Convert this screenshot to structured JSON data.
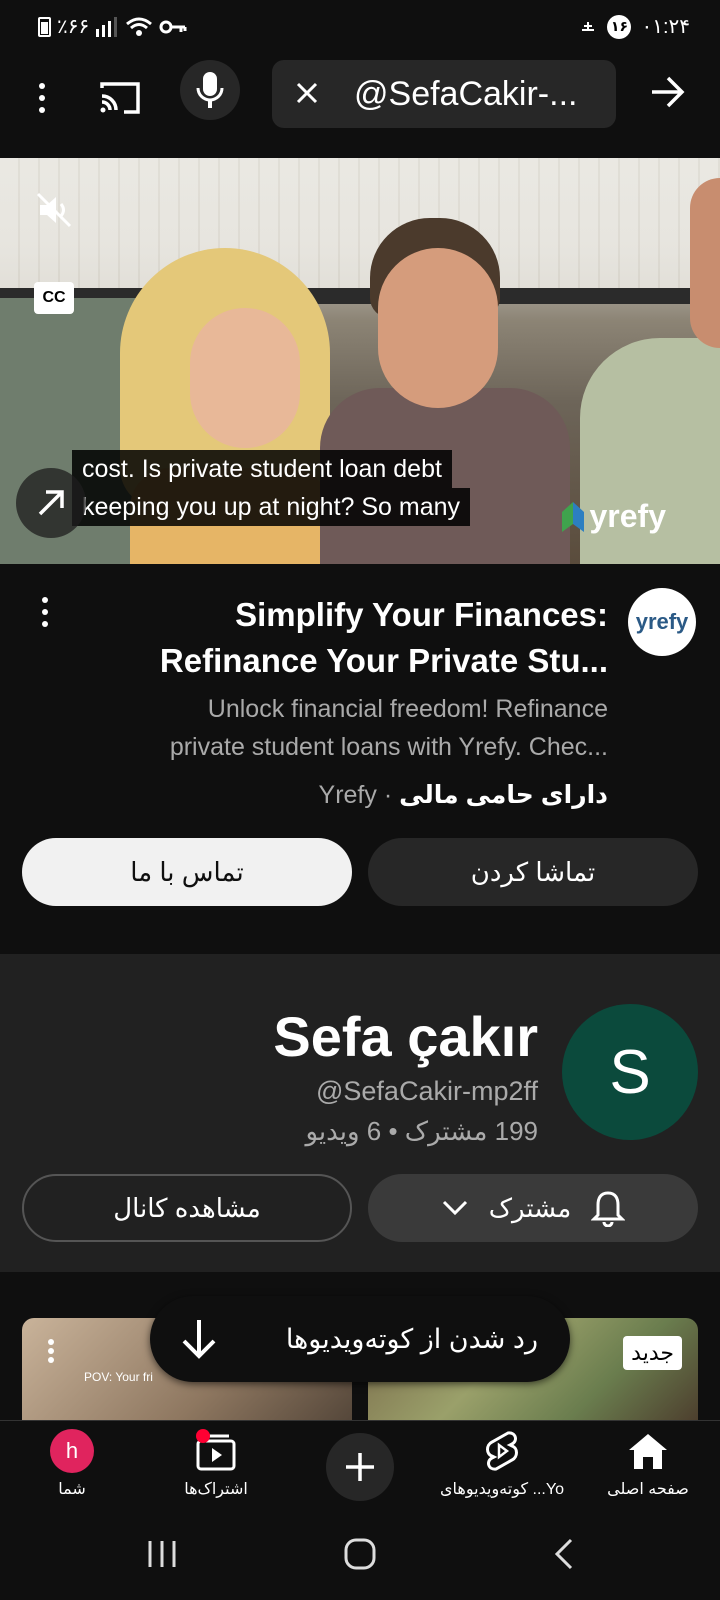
{
  "status_bar": {
    "time": "۰۱:۲۴",
    "notification_count": "۱۶",
    "battery": "٪۶۶"
  },
  "search": {
    "query": "@SefaCakir-..."
  },
  "video": {
    "caption_line1": "cost. Is private student loan debt",
    "caption_line2": "keeping you up at night? So many",
    "watermark": "yrefy",
    "cc_label": "CC"
  },
  "ad": {
    "title_line1": "Simplify Your Finances:",
    "title_line2": "Refinance Your Private Stu...",
    "desc_line1": "Unlock financial freedom! Refinance",
    "desc_line2": "private student loans with Yrefy. Chec...",
    "sponsor_label": "دارای حامی مالی",
    "advertiser": "Yrefy",
    "avatar_text": "yrefy",
    "watch_button": "تماشا کردن",
    "contact_button": "تماس با ما"
  },
  "channel": {
    "name": "Sefa çakır",
    "handle": "@SefaCakir-mp2ff",
    "stats": "199 مشترک • 6 ویدیو",
    "avatar_letter": "S",
    "subscribe_button": "مشترک",
    "view_channel_button": "مشاهده کانال"
  },
  "strip": {
    "toast_text": "رد شدن از کوته‌ویدیوها",
    "thumb1_text": "POV: Your fri",
    "badge_new": "جدید"
  },
  "bottom_nav": {
    "home": "صفحه اصلی",
    "shorts": "کوته‌ویدیوهای ...Yo",
    "subscriptions": "اشتراک‌ها",
    "you": "شما",
    "you_avatar": "h"
  },
  "colors": {
    "background": "#0f0f0f",
    "card": "#212121",
    "channel_avatar": "#0b4a3c",
    "notification_dot": "#ff0033"
  }
}
